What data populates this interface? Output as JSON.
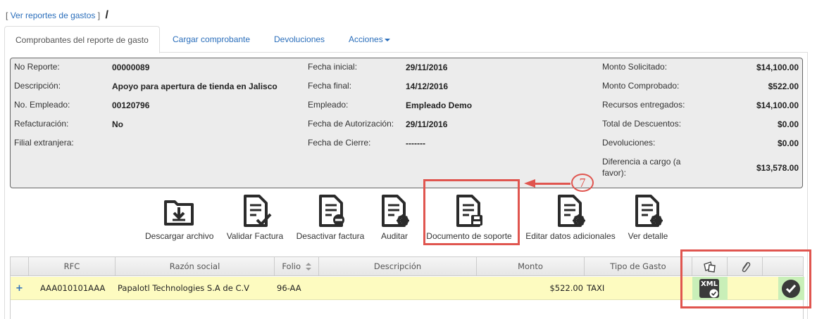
{
  "breadcrumb": {
    "open": "[",
    "link": "Ver reportes de gastos",
    "close": "]",
    "separator": "/"
  },
  "tabs": [
    {
      "label": "Comprobantes del reporte de gasto",
      "active": true
    },
    {
      "label": "Cargar comprobante"
    },
    {
      "label": "Devoluciones"
    },
    {
      "label": "Acciones"
    }
  ],
  "report": {
    "col1": [
      {
        "label": "No Reporte:",
        "value": "00000089"
      },
      {
        "label": "Descripción:",
        "value": "Apoyo para apertura de tienda en Jalisco"
      },
      {
        "label": "No. Empleado:",
        "value": "00120796"
      },
      {
        "label": "Refacturación:",
        "value": "No"
      },
      {
        "label": "Filial extranjera:",
        "value": ""
      }
    ],
    "col2": [
      {
        "label": "Fecha inicial:",
        "value": "29/11/2016"
      },
      {
        "label": "Fecha final:",
        "value": "14/12/2016"
      },
      {
        "label": "Empleado:",
        "value": "Empleado Demo"
      },
      {
        "label": "Fecha de Autorización:",
        "value": "29/11/2016"
      },
      {
        "label": "Fecha de Cierre:",
        "value": "-------"
      }
    ],
    "col3": [
      {
        "label": "Monto Solicitado:",
        "value": "$14,100.00"
      },
      {
        "label": "Monto Comprobado:",
        "value": "$522.00"
      },
      {
        "label": "Recursos entregados:",
        "value": "$14,100.00"
      },
      {
        "label": "Total de Descuentos:",
        "value": "$0.00"
      },
      {
        "label": "Devoluciones:",
        "value": "$0.00"
      },
      {
        "label_line1": "Diferencia a cargo (a",
        "label_line2": "favor):",
        "value": "$13,578.00"
      }
    ]
  },
  "actions": [
    {
      "label": "Descargar archivo",
      "icon": "download-folder-icon"
    },
    {
      "label": "Validar Factura",
      "icon": "validate-invoice-icon"
    },
    {
      "label": "Desactivar factura",
      "icon": "deactivate-invoice-icon"
    },
    {
      "label": "Auditar",
      "icon": "audit-icon"
    },
    {
      "label": "Documento de soporte",
      "icon": "support-document-icon"
    },
    {
      "label": "Editar datos adicionales",
      "icon": "edit-data-icon"
    },
    {
      "label": "Ver detalle",
      "icon": "detail-icon"
    }
  ],
  "annotation": {
    "step": "7",
    "color": "#e0554f"
  },
  "grid": {
    "headers": {
      "rfc": "RFC",
      "razon": "Razón social",
      "folio": "Folio",
      "descripcion": "Descripción",
      "monto": "Monto",
      "tipo": "Tipo de Gasto"
    },
    "row": {
      "expand": "+",
      "rfc": "AAA010101AAA",
      "razon": "Papalotl Technologies S.A de C.V",
      "folio": "96-AA",
      "descripcion": "",
      "monto": "$522.00",
      "tipo": "TAXI",
      "xml": "XML"
    },
    "row_color": "#fdfbc0",
    "status_color": "#c9efb8"
  }
}
